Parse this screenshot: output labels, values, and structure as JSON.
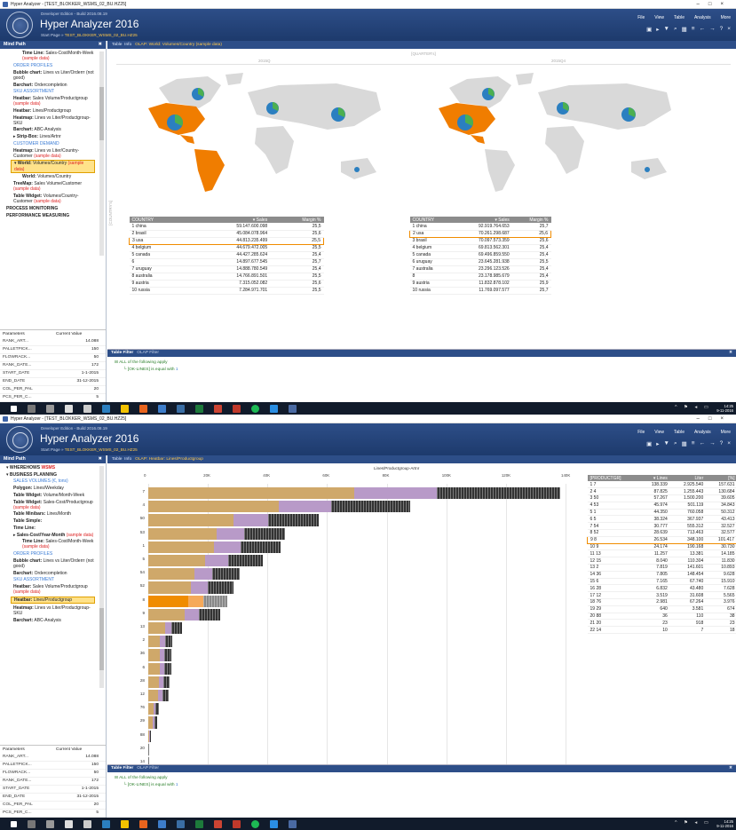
{
  "os_title_1": "Hyper Analyzer - [TEST_BLOKKER_WSMS_02_BU.HZ25]",
  "os_title_2": "Hyper Analyzer - [TEST_BLOKKER_WSMS_02_BU.HZ25]",
  "app": {
    "edition": "Developer Edition - Build 2016.08.19",
    "title": "Hyper Analyzer 2016",
    "start_page_label": "Start Page »",
    "start_page_file": "TEST_BLOKKER_WSMS_02_BU.HZ25"
  },
  "menu": [
    "File",
    "View",
    "Table",
    "Analysis",
    "More"
  ],
  "toolbar_icons": [
    "folder-icon",
    "play-icon",
    "filter-icon",
    "search-icon",
    "grid-icon",
    "sort-icon",
    "back-icon",
    "forward-icon",
    "help-icon",
    "close-icon"
  ],
  "sidebar_title": "Mind Path",
  "sidebar_close": "✖",
  "tree1": [
    {
      "cls": "it ind",
      "title": "Time Line:",
      "body": "Sales-Cost/Month-Week",
      "red": "(sample data)"
    },
    {
      "cls": "it lnk",
      "title": "",
      "body": "ORDER PROFILES",
      "red": ""
    },
    {
      "cls": "it",
      "title": "Bubble chart:",
      "body": "Lines vs Liter/Orderrr (not good)",
      "red": ""
    },
    {
      "cls": "it",
      "title": "Barchart:",
      "body": "Ordercompletion",
      "red": ""
    },
    {
      "cls": "it lnk",
      "title": "",
      "body": "SKU ASSORTMENT",
      "red": ""
    },
    {
      "cls": "it",
      "title": "Heatbar:",
      "body": "Sales Volume/Productgroup",
      "red": "(sample data)"
    },
    {
      "cls": "it",
      "title": "Heatbar:",
      "body": "Lines/Productgroup",
      "red": ""
    },
    {
      "cls": "it",
      "title": "Heatmap:",
      "body": "Lines vs Liter/Productgroup-SKU",
      "red": ""
    },
    {
      "cls": "it",
      "title": "Barchart:",
      "body": "ABC-Analysis",
      "red": ""
    },
    {
      "cls": "it",
      "title": "▸ Strip-Box:",
      "body": "Lines/Artnr",
      "red": ""
    },
    {
      "cls": "it lnk",
      "title": "",
      "body": "CUSTOMER DEMAND",
      "red": ""
    },
    {
      "cls": "it",
      "title": "Heatmap:",
      "body": "Lines vs Liter/Country-Customer",
      "red": "(sample data)"
    },
    {
      "cls": "it sel",
      "title": "▾ World:",
      "body": "Volumes/Country",
      "red": "(sample data)"
    },
    {
      "cls": "it ind",
      "title": "World:",
      "body": "Volumes/Country",
      "red": ""
    },
    {
      "cls": "it",
      "title": "TreeMap:",
      "body": "Sales Volume/Customer",
      "red": "(sample data)"
    },
    {
      "cls": "it",
      "title": "Table Widget:",
      "body": "Volumes/Country-Customer",
      "red": "(sample data)"
    },
    {
      "cls": "it sec",
      "title": "PROCESS MONITORING",
      "body": "",
      "red": ""
    },
    {
      "cls": "it sec",
      "title": "PERFORMANCE MEASURING",
      "body": "",
      "red": ""
    }
  ],
  "tree2": [
    {
      "cls": "it sec",
      "title": "▾ WHEREHOWS",
      "body": "",
      "red": "WSMS"
    },
    {
      "cls": "it sec",
      "title": "▾ BUSINESS PLANNING",
      "body": "",
      "red": ""
    },
    {
      "cls": "it lnk",
      "title": "",
      "body": "SALES VOLUMES (€, tons)",
      "red": ""
    },
    {
      "cls": "it",
      "title": "Polygon:",
      "body": "Lines/Weekday",
      "red": ""
    },
    {
      "cls": "it",
      "title": "Table Widget:",
      "body": "Volume/Month-Week",
      "red": ""
    },
    {
      "cls": "it",
      "title": "Table Widget:",
      "body": "Sales-Cost/Productgroup",
      "red": "(sample data)"
    },
    {
      "cls": "it",
      "title": "Table Minibars:",
      "body": "Lines/Month",
      "red": ""
    },
    {
      "cls": "it",
      "title": "Table Simple:",
      "body": "",
      "red": ""
    },
    {
      "cls": "it",
      "title": "Time Line:",
      "body": "",
      "red": ""
    },
    {
      "cls": "it",
      "title": "▸ Sales-Cost/Year-Month",
      "body": "",
      "red": "(sample data)"
    },
    {
      "cls": "it ind",
      "title": "Time Line:",
      "body": "Sales-Cost/Month-Week",
      "red": "(sample data)"
    },
    {
      "cls": "it lnk",
      "title": "",
      "body": "ORDER PROFILES",
      "red": ""
    },
    {
      "cls": "it",
      "title": "Bubble chart:",
      "body": "Lines vs Liter/Orderrr (not good)",
      "red": ""
    },
    {
      "cls": "it",
      "title": "Barchart:",
      "body": "Ordercompletion",
      "red": ""
    },
    {
      "cls": "it lnk",
      "title": "",
      "body": "SKU ASSORTMENT",
      "red": ""
    },
    {
      "cls": "it",
      "title": "Heatbar:",
      "body": "Sales Volume/Productgroup",
      "red": "(sample data)"
    },
    {
      "cls": "it sel",
      "title": "Heatbar:",
      "body": "Lines/Productgroup",
      "red": ""
    },
    {
      "cls": "it",
      "title": "Heatmap:",
      "body": "Lines vs Liter/Productgroup-SKU",
      "red": ""
    },
    {
      "cls": "it",
      "title": "Barchart:",
      "body": "ABC-Analysis",
      "red": ""
    }
  ],
  "params_header": [
    "Parameters",
    "Current Value"
  ],
  "params": [
    {
      "name": "RANK_ART...",
      "value": "14.088"
    },
    {
      "name": "PALLETPICK...",
      "value": "150"
    },
    {
      "name": "FLOWRACK...",
      "value": "50"
    },
    {
      "name": "RANK_DATE...",
      "value": "172"
    },
    {
      "name": "START_DATE",
      "value": "1-1-2015"
    },
    {
      "name": "END_DATE",
      "value": "31-12-2015"
    },
    {
      "name": "COL_PER_PAL",
      "value": "20"
    },
    {
      "name": "PCS_PER_C...",
      "value": "5"
    },
    {
      "name": "LAY_PER_PAL",
      "value": "5"
    }
  ],
  "tab1": {
    "table": "Table",
    "info": "Info",
    "olap": "OLAP: World: Volumes/Country (sample data)"
  },
  "tab2": {
    "table": "Table",
    "info": "Info",
    "olap": "OLAP: Heatbar: Lines/Productgroup"
  },
  "quarter_label": "[QUARTER's]",
  "years": [
    "2015Q",
    "2015Q4"
  ],
  "country_axis": "[COUNTRY's]",
  "world_headers": [
    "COUNTRY",
    "▾ Sales",
    "Margin %"
  ],
  "world_left": [
    [
      "1 china",
      "59.147.600.098",
      "25,5"
    ],
    [
      "2 brasil",
      "45.084.078.964",
      "25,6"
    ],
    [
      "3 usa",
      "44.813.235.499",
      "25,5"
    ],
    [
      "4 belgium",
      "44.679.472.005",
      "25,5"
    ],
    [
      "5 canada",
      "44.427.285.624",
      "25,4"
    ],
    [
      "6",
      "14.897.677.545",
      "25,7"
    ],
    [
      "7 uruguay",
      "14.888.780.549",
      "25,4"
    ],
    [
      "8 australia",
      "14.766.891.501",
      "25,5"
    ],
    [
      "9 austria",
      "7.315.052.082",
      "25,6"
    ],
    [
      "10 russia",
      "7.284.971.701",
      "25,5"
    ]
  ],
  "world_right": [
    [
      "1 china",
      "92.919.764.653",
      "25,7"
    ],
    [
      "2 usa",
      "70.261.298.687",
      "25,6"
    ],
    [
      "3 brasil",
      "70.097.573.359",
      "25,6"
    ],
    [
      "4 belgium",
      "69.813.562.301",
      "25,4"
    ],
    [
      "5 canada",
      "69.496.859.550",
      "25,4"
    ],
    [
      "6 uruguay",
      "23.645.281.938",
      "25,5"
    ],
    [
      "7 australia",
      "23.296.123.526",
      "25,4"
    ],
    [
      "8",
      "23.178.985.679",
      "25,4"
    ],
    [
      "9 austria",
      "11.832.878.102",
      "25,9"
    ],
    [
      "10 russia",
      "11.769.097.577",
      "25,7"
    ]
  ],
  "filter": {
    "title": "Table Filter",
    "sub": "OLAP Filter",
    "rule": "ALL of the following apply",
    "cond": "[OK-LINES] is equal with",
    "val": "1"
  },
  "heatbar": {
    "title": "Lines/Productgroup-Artnr",
    "ticks": [
      "0",
      "20K",
      "40K",
      "60K",
      "80K",
      "100K",
      "120K",
      "140K"
    ]
  },
  "chart_data": {
    "type": "bar",
    "title": "Lines/Productgroup-Artnr",
    "categories": [
      "7",
      "4",
      "50",
      "53",
      "1",
      "5",
      "54",
      "52",
      "8",
      "9",
      "13",
      "2",
      "36",
      "6",
      "28",
      "12",
      "76",
      "29",
      "88",
      "20",
      "14"
    ],
    "values": [
      138339,
      87825,
      57267,
      45974,
      44350,
      38324,
      30777,
      28639,
      26534,
      24174,
      11257,
      8040,
      7819,
      7805,
      7165,
      6832,
      3519,
      2981,
      640,
      36,
      10
    ],
    "xlim": [
      0,
      140000
    ]
  },
  "ptable_headers": [
    "[PRODUCTGR]",
    "▾ Lines",
    "Liter",
    "[%]"
  ],
  "ptable": [
    [
      "1 7",
      "138.339",
      "2.925.540",
      "157.631"
    ],
    [
      "2 4",
      "87.825",
      "1.255.443",
      "130.684"
    ],
    [
      "3 50",
      "57.267",
      "1.500.200",
      "39.605"
    ],
    [
      "4 53",
      "45.974",
      "501.119",
      "34.843"
    ],
    [
      "5 1",
      "44.350",
      "760.058",
      "50.312"
    ],
    [
      "6 5",
      "38.324",
      "367.937",
      "43.413"
    ],
    [
      "7 54",
      "30.777",
      "555.312",
      "32.527"
    ],
    [
      "8 52",
      "28.639",
      "713.463",
      "32.577"
    ],
    [
      "9 8",
      "26.534",
      "348.100",
      "101.417"
    ],
    [
      "10 9",
      "24.174",
      "190.168",
      "30.730"
    ],
    [
      "11 13",
      "11.257",
      "13.381",
      "14.185"
    ],
    [
      "12 15",
      "8.040",
      "110.304",
      "11.830"
    ],
    [
      "13 2",
      "7.819",
      "141.601",
      "10.893"
    ],
    [
      "14 36",
      "7.805",
      "148.454",
      "9.628"
    ],
    [
      "15 6",
      "7.165",
      "67.740",
      "15.910"
    ],
    [
      "16 28",
      "6.832",
      "43.480",
      "7.628"
    ],
    [
      "17 12",
      "3.519",
      "31.608",
      "5.565"
    ],
    [
      "18 76",
      "2.981",
      "67.264",
      "3.976"
    ],
    [
      "19 29",
      "640",
      "3.581",
      "674"
    ],
    [
      "20 88",
      "36",
      "110",
      "38"
    ],
    [
      "21 20",
      "23",
      "918",
      "23"
    ],
    [
      "22 14",
      "10",
      "7",
      "18"
    ]
  ],
  "clock": {
    "time": "14:25",
    "date": "9-11-2016"
  },
  "colors": {
    "header": "#2d4e88",
    "accent": "#f08c00",
    "map_highlight": "#f07d00",
    "bar_tan": "#cfa86a",
    "bar_lilac": "#b89ac8"
  }
}
